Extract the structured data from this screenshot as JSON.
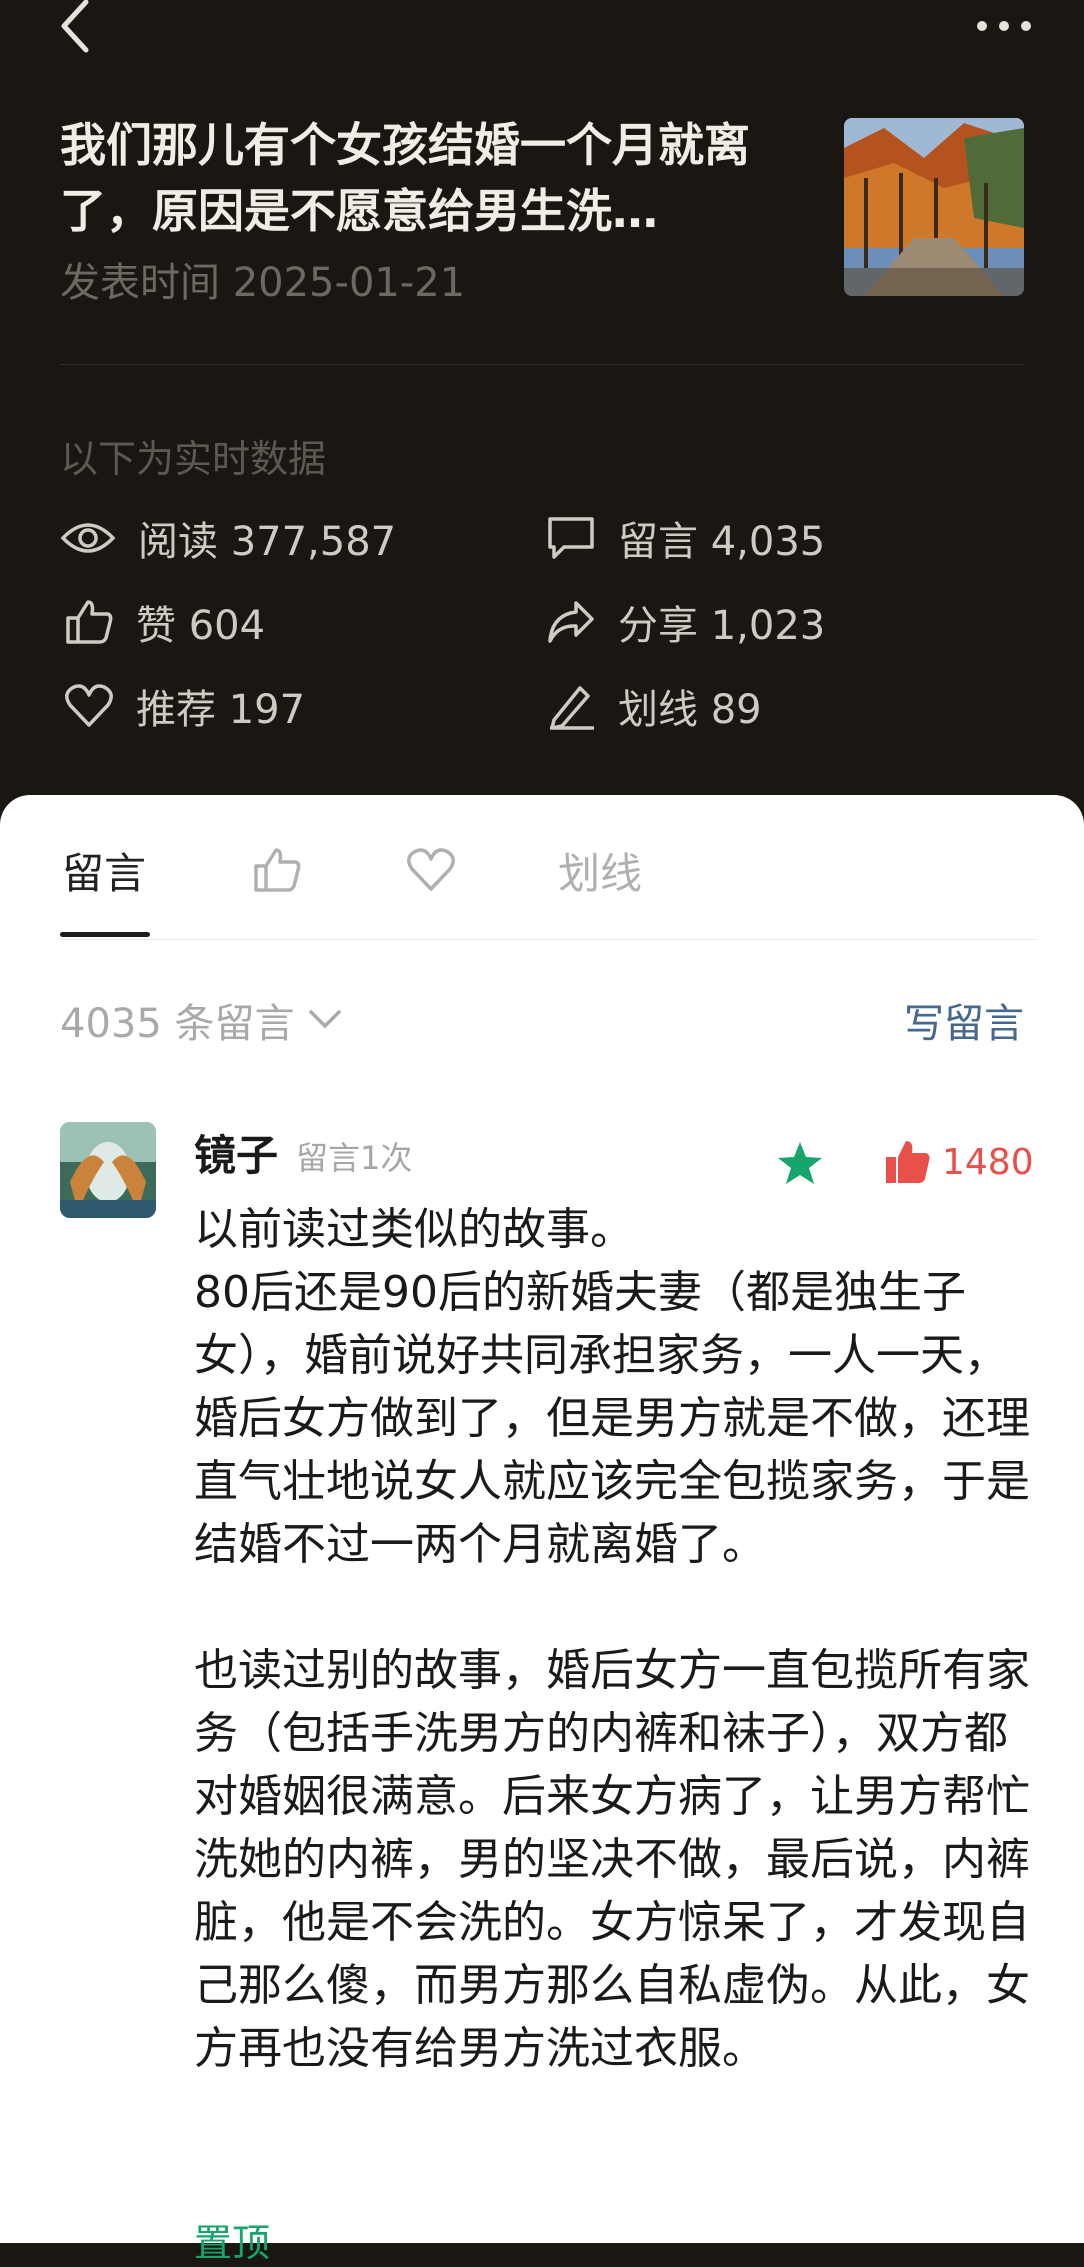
{
  "article": {
    "title": "我们那儿有个女孩结婚一个月就离了，原因是不愿意给男生洗…",
    "date": "发表时间 2025-01-21"
  },
  "realtime_label": "以下为实时数据",
  "stats": {
    "read": "阅读 377,587",
    "comment": "留言 4,035",
    "like": "赞 604",
    "share": "分享 1,023",
    "recommend": "推荐 197",
    "underline": "划线 89"
  },
  "tabs": {
    "comments": "留言",
    "underline": "划线"
  },
  "comment_count": "4035 条留言",
  "write_comment": "写留言",
  "comment": {
    "username": "镜子",
    "user_meta": "留言1次",
    "likes": "1480",
    "text": "以前读过类似的故事。\n80后还是90后的新婚夫妻（都是独生子女），婚前说好共同承担家务，一人一天，婚后女方做到了，但是男方就是不做，还理直气壮地说女人就应该完全包揽家务，于是结婚不过一两个月就离婚了。\n\n也读过别的故事，婚后女方一直包揽所有家务（包括手洗男方的内裤和袜子），双方都对婚姻很满意。后来女方病了，让男方帮忙洗她的内裤，男的坚决不做，最后说，内裤脏，他是不会洗的。女方惊呆了，才发现自己那么傻，而男方那么自私虚伪。从此，女方再也没有给男方洗过衣服。",
    "pinned": "置顶"
  },
  "colors": {
    "dark_bg": "#1a1612",
    "link_blue": "#46678f",
    "like_red": "#e9504a",
    "star_green": "#16a56b"
  }
}
